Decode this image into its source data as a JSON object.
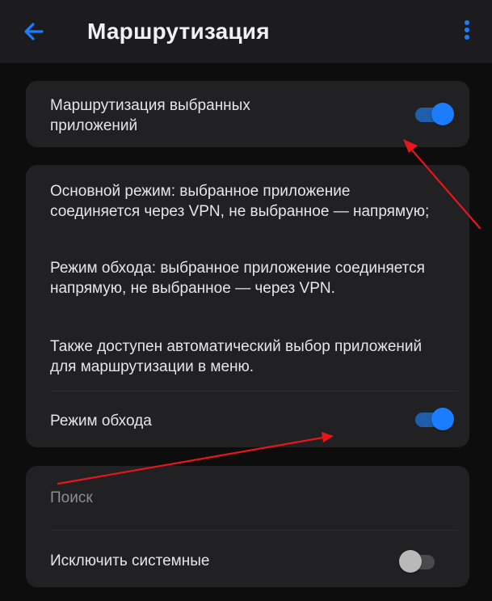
{
  "header": {
    "title": "Маршрутизация",
    "back_icon": "arrow-left-icon",
    "menu_icon": "more-vertical-icon"
  },
  "routing_card": {
    "label": "Маршрутизация выбранных приложений",
    "toggle_on": true
  },
  "mode_card": {
    "desc_main_mode": "Основной режим: выбранное приложение соединяется через VPN, не выбранное — напрямую;",
    "desc_bypass_mode": "Режим обхода: выбранное приложение соединяется напрямую, не выбранное — через VPN.",
    "desc_auto": "Также доступен автоматический выбор приложений для маршрутизации в меню.",
    "bypass_label": "Режим обхода",
    "bypass_toggle_on": true
  },
  "apps_card": {
    "search_placeholder": "Поиск",
    "exclude_system_label": "Исключить системные",
    "exclude_system_toggle_on": false
  },
  "colors": {
    "accent": "#1a7dff",
    "annotation_arrow": "#e8161b",
    "card_background": "#212123",
    "page_background": "#0d0d0d"
  }
}
